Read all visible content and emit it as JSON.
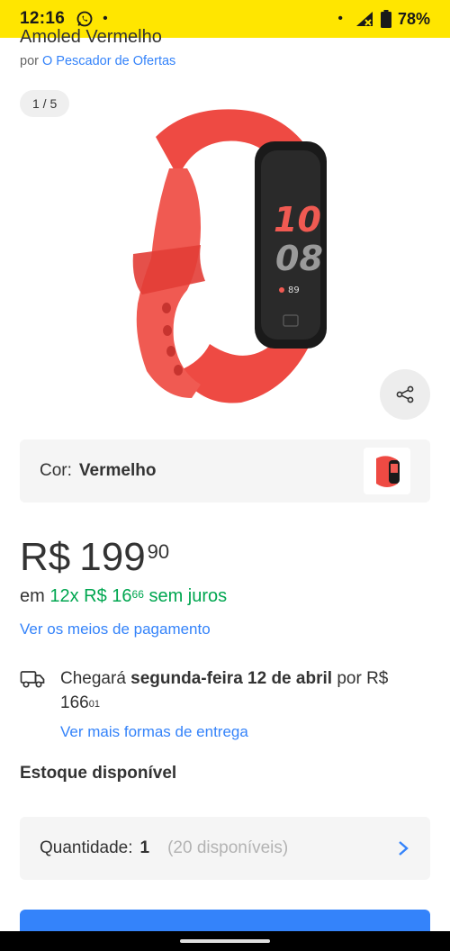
{
  "status_bar": {
    "time": "12:16",
    "battery": "78%",
    "dot": "•",
    "icons": [
      "whatsapp-icon",
      "signal-icon",
      "battery-icon"
    ]
  },
  "product": {
    "title_partial": "Amoled Vermelho",
    "seller_prefix": "por",
    "seller_name": "O Pescador de Ofertas",
    "gallery_counter": "1 / 5",
    "watch_time_hours": "10",
    "watch_time_minutes": "08",
    "watch_heart_rate": "89"
  },
  "variant": {
    "label": "Cor:",
    "value": "Vermelho"
  },
  "price": {
    "currency": "R$",
    "integer": "199",
    "cents": "90"
  },
  "installments": {
    "prefix": "em",
    "count_and_currency": "12x R$ 16",
    "cents": "66",
    "suffix": "sem juros"
  },
  "payment_link": "Ver os meios de pagamento",
  "delivery": {
    "prefix": "Chegará",
    "date": "segunda-feira 12 de abril",
    "connector": "por",
    "price": "R$ 166",
    "price_cents": "01",
    "link": "Ver mais formas de entrega"
  },
  "stock": {
    "title": "Estoque disponível"
  },
  "quantity": {
    "label": "Quantidade:",
    "value": "1",
    "available": "(20 disponíveis)"
  },
  "colors": {
    "brand_yellow": "#ffe600",
    "link_blue": "#3483fa",
    "green": "#00a650",
    "product_red": "#ef4c45"
  }
}
